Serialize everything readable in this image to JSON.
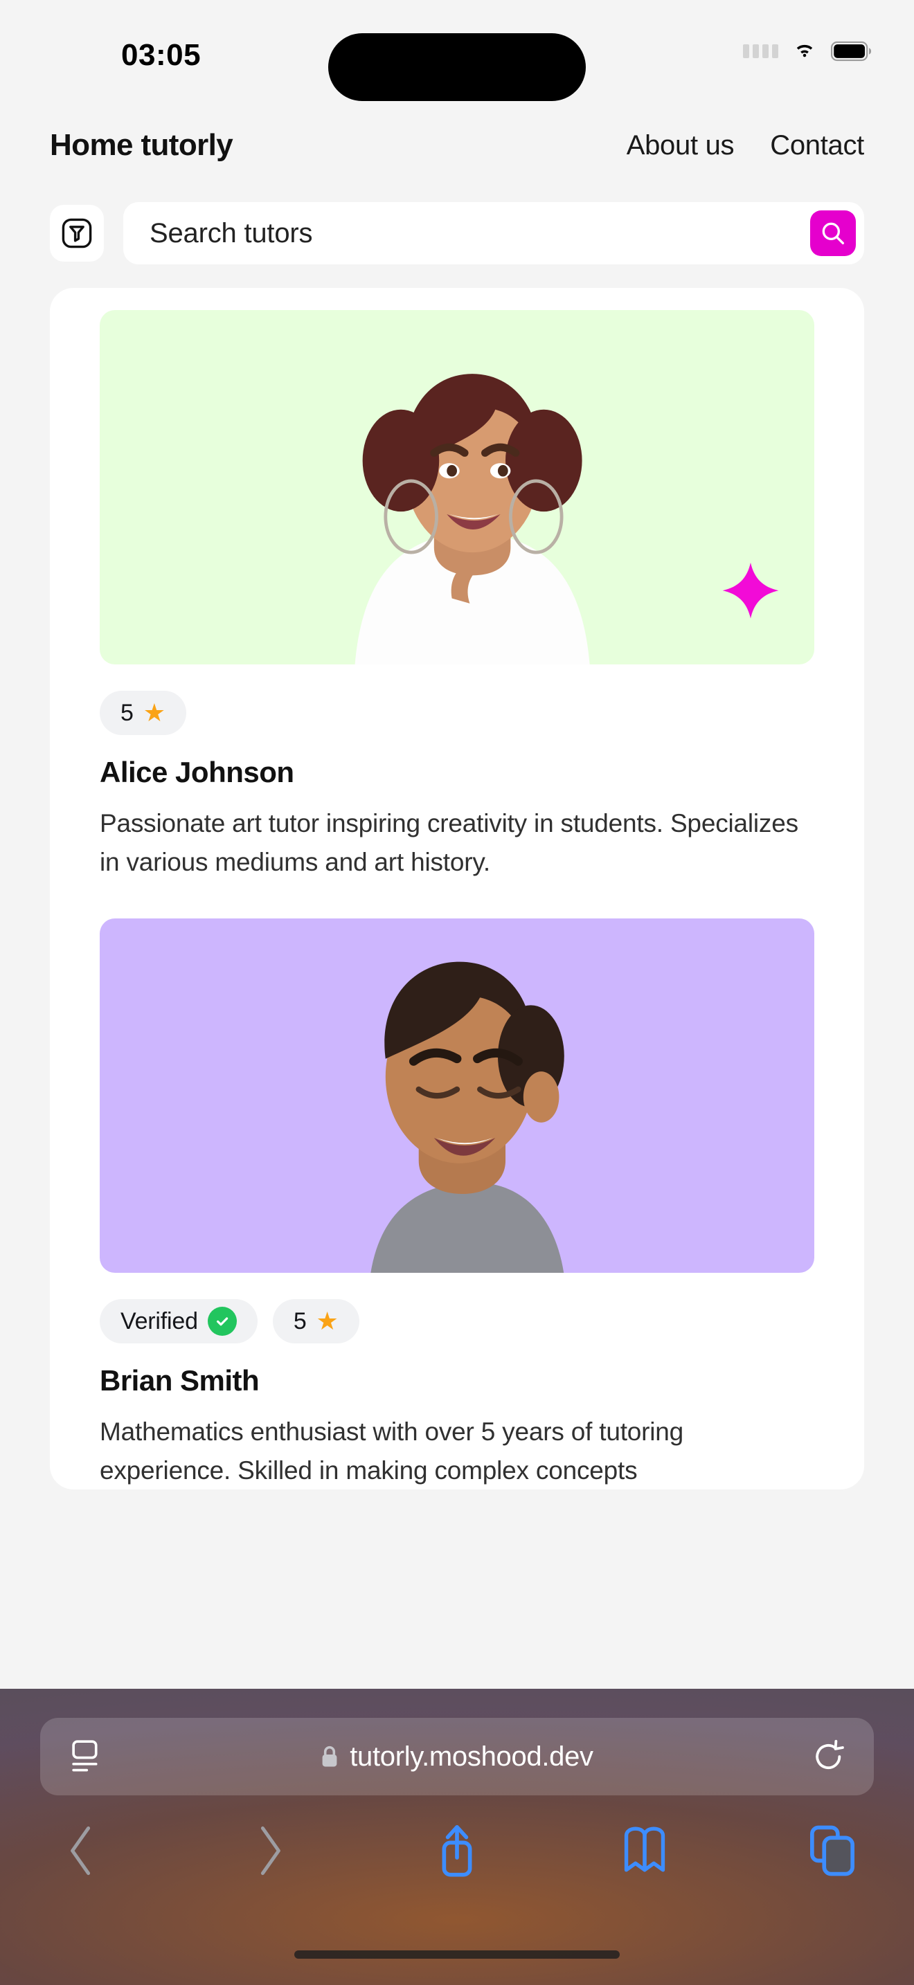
{
  "status_bar": {
    "time": "03:05",
    "icons": [
      "signal-dots-icon",
      "wifi-icon",
      "battery-icon"
    ]
  },
  "site_nav": {
    "brand": "Home tutorly",
    "links": [
      {
        "label": "About us"
      },
      {
        "label": "Contact"
      }
    ]
  },
  "search": {
    "filter_icon": "filter-funnel-icon",
    "placeholder": "Search tutors",
    "value": "",
    "submit_icon": "search-icon",
    "accent_color": "#e500cd"
  },
  "tutors": [
    {
      "name": "Alice Johnson",
      "description": "Passionate art tutor inspiring creativity in students. Specializes in various mediums and art history.",
      "photo_background": "#e7ffdc",
      "has_sparkle": true,
      "badges": [
        {
          "type": "rating",
          "label": "5",
          "icon": "star-icon"
        }
      ]
    },
    {
      "name": "Brian Smith",
      "description": "Mathematics enthusiast with over 5 years of tutoring experience. Skilled in making complex concepts",
      "photo_background": "#cdb6fe",
      "has_sparkle": false,
      "badges": [
        {
          "type": "verified",
          "label": "Verified",
          "icon": "check-circle-icon"
        },
        {
          "type": "rating",
          "label": "5",
          "icon": "star-icon"
        }
      ]
    }
  ],
  "browser": {
    "reader_icon": "reader-view-icon",
    "lock_icon": "lock-icon",
    "url": "tutorly.moshood.dev",
    "reload_icon": "reload-icon",
    "toolbar": [
      {
        "name": "back",
        "icon": "chevron-left-icon",
        "enabled": false
      },
      {
        "name": "forward",
        "icon": "chevron-right-icon",
        "enabled": false
      },
      {
        "name": "share",
        "icon": "share-icon",
        "enabled": true
      },
      {
        "name": "bookmarks",
        "icon": "book-icon",
        "enabled": true
      },
      {
        "name": "tabs",
        "icon": "tabs-icon",
        "enabled": true
      }
    ],
    "tint_color": "#3d8dff"
  },
  "colors": {
    "page_background": "#f4f4f4",
    "card_background": "#ffffff",
    "badge_background": "#f1f2f4",
    "star": "#faa316",
    "verified": "#22c55e",
    "accent": "#e500cd"
  }
}
